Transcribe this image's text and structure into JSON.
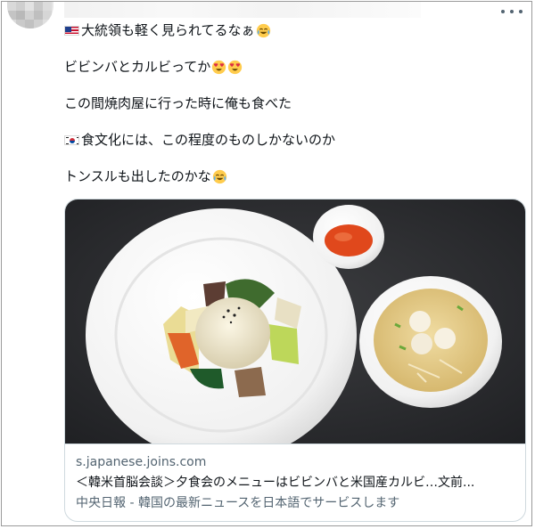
{
  "tweet": {
    "lines": [
      {
        "text": "大統領も軽く見られてるなぁ",
        "flag": "us-flag",
        "trailing_emoji": "face-with-tears-of-joy"
      },
      {
        "text": "ビビンバとカルビってか",
        "trailing_emoji": "smiling-face-with-heart-eyes x2"
      },
      {
        "text": "この間焼肉屋に行った時に俺も食べた"
      },
      {
        "text": "食文化には、この程度のものしかないのか",
        "flag": "kr-flag"
      },
      {
        "text": "トンスルも出したのかな",
        "trailing_emoji": "face-with-tears-of-joy"
      }
    ]
  },
  "link_card": {
    "domain": "s.japanese.joins.com",
    "title": "＜韓米首脳会談＞夕食会のメニューはビビンバと米国産カルビ…文前...",
    "description": "中央日報 - 韓国の最新ニュースを日本語でサービスします"
  },
  "colors": {
    "text": "#0f1419",
    "secondary_text": "#536471",
    "border": "#cfd9de"
  }
}
